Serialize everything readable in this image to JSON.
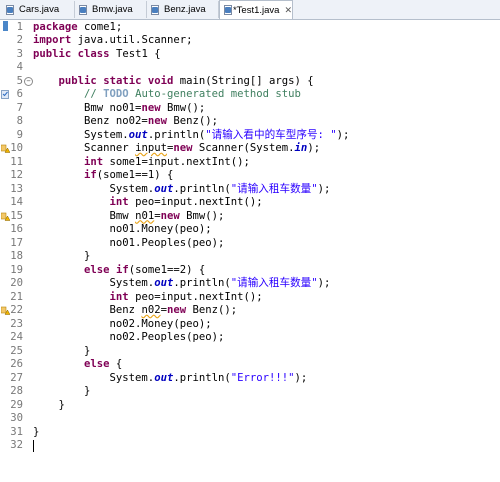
{
  "tabs": [
    {
      "label": "Cars.java",
      "active": false
    },
    {
      "label": "Bmw.java",
      "active": false
    },
    {
      "label": "Benz.java",
      "active": false
    },
    {
      "label": "*Test1.java",
      "active": true
    }
  ],
  "close_glyph": "✕",
  "lines": [
    {
      "n": "1",
      "segs": [
        [
          "kw",
          "package"
        ],
        [
          "t",
          " come1;"
        ]
      ]
    },
    {
      "n": "2",
      "segs": [
        [
          "kw",
          "import"
        ],
        [
          "t",
          " java.util.Scanner;"
        ]
      ]
    },
    {
      "n": "3",
      "segs": [
        [
          "kw",
          "public"
        ],
        [
          "t",
          " "
        ],
        [
          "kw",
          "class"
        ],
        [
          "t",
          " Test1 {"
        ]
      ]
    },
    {
      "n": "4",
      "segs": []
    },
    {
      "n": "5",
      "segs": [
        [
          "t",
          "    "
        ],
        [
          "kw",
          "public"
        ],
        [
          "t",
          " "
        ],
        [
          "kw",
          "static"
        ],
        [
          "t",
          " "
        ],
        [
          "kw",
          "void"
        ],
        [
          "t",
          " main(String[] args) {"
        ]
      ],
      "fold": true
    },
    {
      "n": "6",
      "segs": [
        [
          "t",
          "        "
        ],
        [
          "cm",
          "// "
        ],
        [
          "todo",
          "TODO"
        ],
        [
          "cm",
          " Auto-generated method stub"
        ]
      ],
      "icon": "task"
    },
    {
      "n": "7",
      "segs": [
        [
          "t",
          "        Bmw no01="
        ],
        [
          "kw",
          "new"
        ],
        [
          "t",
          " Bmw();"
        ]
      ]
    },
    {
      "n": "8",
      "segs": [
        [
          "t",
          "        Benz no02="
        ],
        [
          "kw",
          "new"
        ],
        [
          "t",
          " Benz();"
        ]
      ]
    },
    {
      "n": "9",
      "segs": [
        [
          "t",
          "        System."
        ],
        [
          "fld",
          "out"
        ],
        [
          "t",
          ".println("
        ],
        [
          "st",
          "\"请输入看中的车型序号: \""
        ],
        [
          "t",
          ");"
        ]
      ]
    },
    {
      "n": "10",
      "segs": [
        [
          "t",
          "        Scanner "
        ],
        [
          "wv",
          "input"
        ],
        [
          "t",
          "="
        ],
        [
          "kw",
          "new"
        ],
        [
          "t",
          " Scanner(System."
        ],
        [
          "fld",
          "in"
        ],
        [
          "t",
          ");"
        ]
      ],
      "icon": "warn"
    },
    {
      "n": "11",
      "segs": [
        [
          "t",
          "        "
        ],
        [
          "kw",
          "int"
        ],
        [
          "t",
          " some1=input.nextInt();"
        ]
      ]
    },
    {
      "n": "12",
      "segs": [
        [
          "t",
          "        "
        ],
        [
          "kw",
          "if"
        ],
        [
          "t",
          "(some1==1) {"
        ]
      ]
    },
    {
      "n": "13",
      "segs": [
        [
          "t",
          "            System."
        ],
        [
          "fld",
          "out"
        ],
        [
          "t",
          ".println("
        ],
        [
          "st",
          "\"请输入租车数量\""
        ],
        [
          "t",
          ");"
        ]
      ]
    },
    {
      "n": "14",
      "segs": [
        [
          "t",
          "            "
        ],
        [
          "kw",
          "int"
        ],
        [
          "t",
          " peo=input.nextInt();"
        ]
      ]
    },
    {
      "n": "15",
      "segs": [
        [
          "t",
          "            Bmw "
        ],
        [
          "wv",
          "n01"
        ],
        [
          "t",
          "="
        ],
        [
          "kw",
          "new"
        ],
        [
          "t",
          " Bmw();"
        ]
      ],
      "icon": "warn"
    },
    {
      "n": "16",
      "segs": [
        [
          "t",
          "            no01.Money(peo);"
        ]
      ]
    },
    {
      "n": "17",
      "segs": [
        [
          "t",
          "            no01.Peoples(peo);"
        ]
      ]
    },
    {
      "n": "18",
      "segs": [
        [
          "t",
          "        }"
        ]
      ]
    },
    {
      "n": "19",
      "segs": [
        [
          "t",
          "        "
        ],
        [
          "kw",
          "else"
        ],
        [
          "t",
          " "
        ],
        [
          "kw",
          "if"
        ],
        [
          "t",
          "(some1==2) {"
        ]
      ]
    },
    {
      "n": "20",
      "segs": [
        [
          "t",
          "            System."
        ],
        [
          "fld",
          "out"
        ],
        [
          "t",
          ".println("
        ],
        [
          "st",
          "\"请输入租车数量\""
        ],
        [
          "t",
          ");"
        ]
      ]
    },
    {
      "n": "21",
      "segs": [
        [
          "t",
          "            "
        ],
        [
          "kw",
          "int"
        ],
        [
          "t",
          " peo=input.nextInt();"
        ]
      ]
    },
    {
      "n": "22",
      "segs": [
        [
          "t",
          "            Benz "
        ],
        [
          "wv",
          "n02"
        ],
        [
          "t",
          "="
        ],
        [
          "kw",
          "new"
        ],
        [
          "t",
          " Benz();"
        ]
      ],
      "icon": "warn"
    },
    {
      "n": "23",
      "segs": [
        [
          "t",
          "            no02.Money(peo);"
        ]
      ]
    },
    {
      "n": "24",
      "segs": [
        [
          "t",
          "            no02.Peoples(peo);"
        ]
      ]
    },
    {
      "n": "25",
      "segs": [
        [
          "t",
          "        }"
        ]
      ]
    },
    {
      "n": "26",
      "segs": [
        [
          "t",
          "        "
        ],
        [
          "kw",
          "else"
        ],
        [
          "t",
          " {"
        ]
      ]
    },
    {
      "n": "27",
      "segs": [
        [
          "t",
          "            System."
        ],
        [
          "fld",
          "out"
        ],
        [
          "t",
          ".println("
        ],
        [
          "st",
          "\"Error!!!\""
        ],
        [
          "t",
          ");"
        ]
      ]
    },
    {
      "n": "28",
      "segs": [
        [
          "t",
          "        }"
        ]
      ]
    },
    {
      "n": "29",
      "segs": [
        [
          "t",
          "    }"
        ]
      ]
    },
    {
      "n": "30",
      "segs": []
    },
    {
      "n": "31",
      "segs": [
        [
          "t",
          "}"
        ]
      ]
    },
    {
      "n": "32",
      "segs": []
    }
  ],
  "colors": {
    "keyword": "#7f0055",
    "comment": "#3f7f5f",
    "string": "#2a00ff",
    "field": "#0000c0",
    "line_number": "#787878",
    "warning": "#e8a317"
  }
}
